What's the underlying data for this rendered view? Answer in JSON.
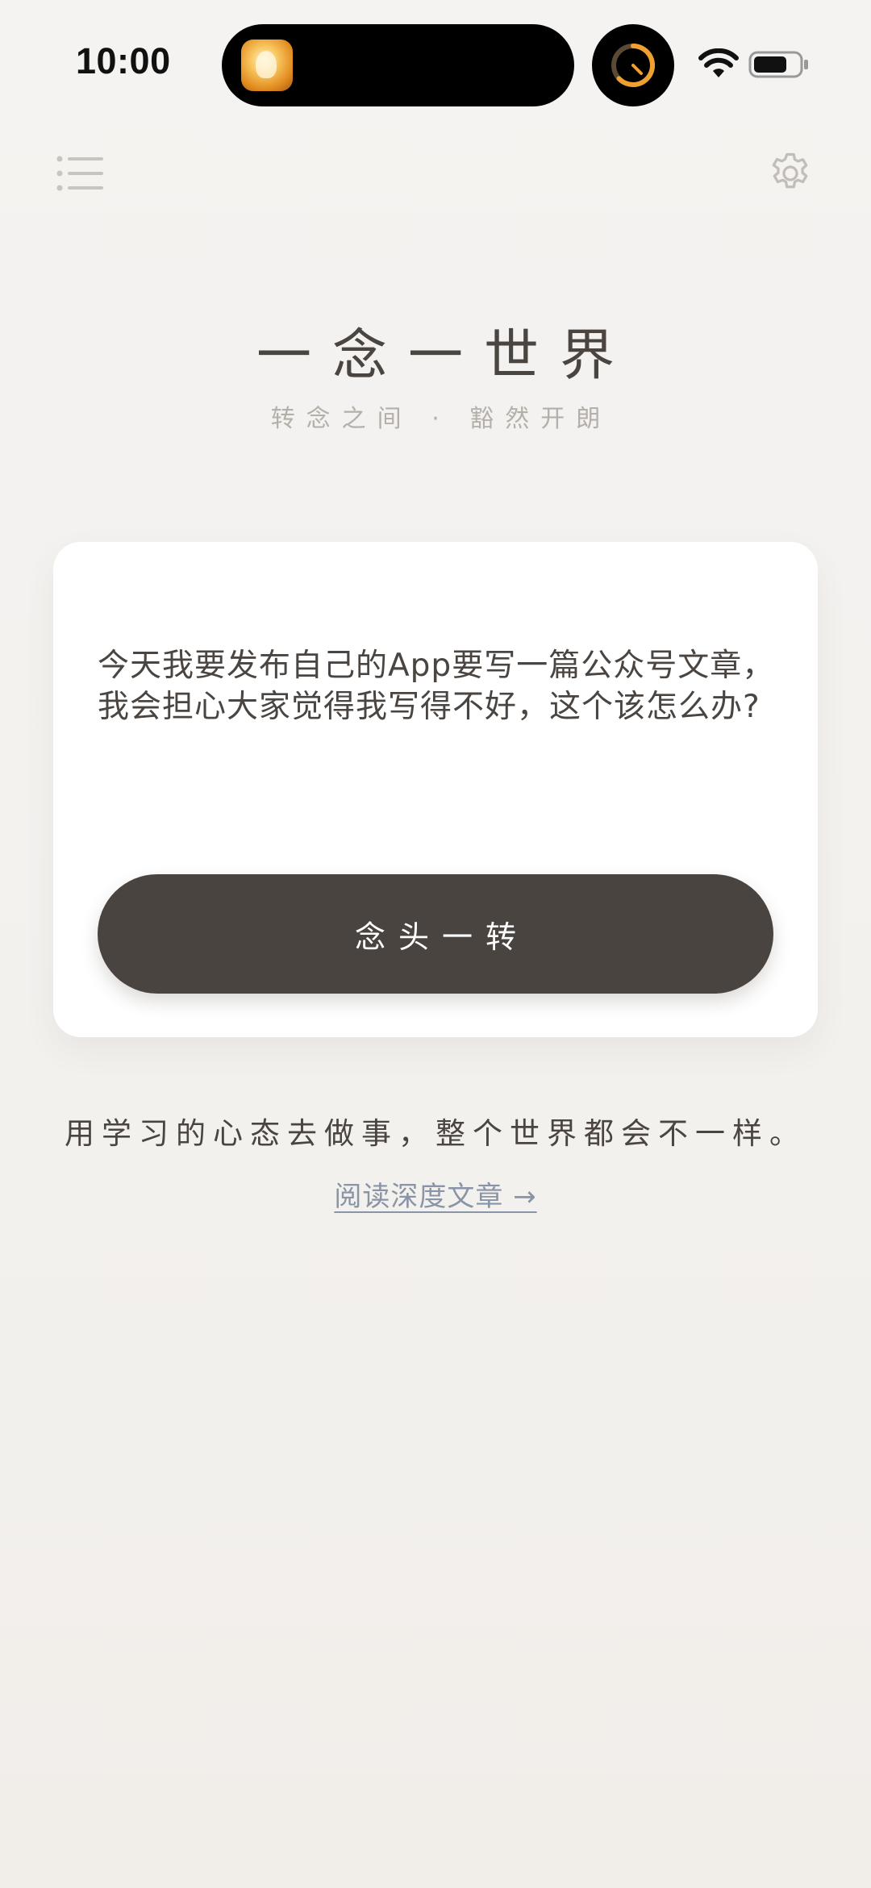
{
  "status_bar": {
    "time": "10:00"
  },
  "nav": {
    "menu_icon": "list-icon",
    "settings_icon": "gear-icon"
  },
  "header": {
    "title": "一念一世界",
    "subtitle": "转念之间 · 豁然开朗"
  },
  "card": {
    "thought": "今天我要发布自己的App要写一篇公众号文章，我会担心大家觉得我写得不好，这个该怎么办?",
    "button_label": "念头一转"
  },
  "footer": {
    "quote": "用学习的心态去做事，整个世界都会不一样。",
    "link_label": "阅读深度文章 →"
  },
  "colors": {
    "accent_dark": "#4a4440",
    "text_primary": "#4a4541",
    "text_muted": "#b4afa9",
    "link": "#8994a6",
    "timer_orange": "#f0a030"
  }
}
